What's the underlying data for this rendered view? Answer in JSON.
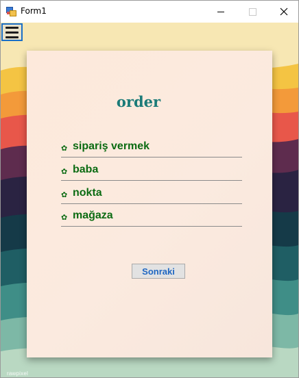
{
  "window": {
    "title": "Form1",
    "controls": {
      "minimize": "—",
      "maximize": "☐",
      "close": "✕"
    }
  },
  "menu_button": {
    "icon": "hamburger-menu-icon"
  },
  "card": {
    "title": "order",
    "items": [
      {
        "icon": "flower-bullet-icon",
        "label": "sipariş vermek"
      },
      {
        "icon": "flower-bullet-icon",
        "label": "baba"
      },
      {
        "icon": "flower-bullet-icon",
        "label": "nokta"
      },
      {
        "icon": "flower-bullet-icon",
        "label": "mağaza"
      }
    ],
    "next_button": "Sonraki"
  },
  "watermark": "rawpixel",
  "colors": {
    "title_color": "#1b7b78",
    "item_color": "#0b6b12",
    "button_text": "#1f67c2",
    "menu_border": "#1a6fc7"
  }
}
